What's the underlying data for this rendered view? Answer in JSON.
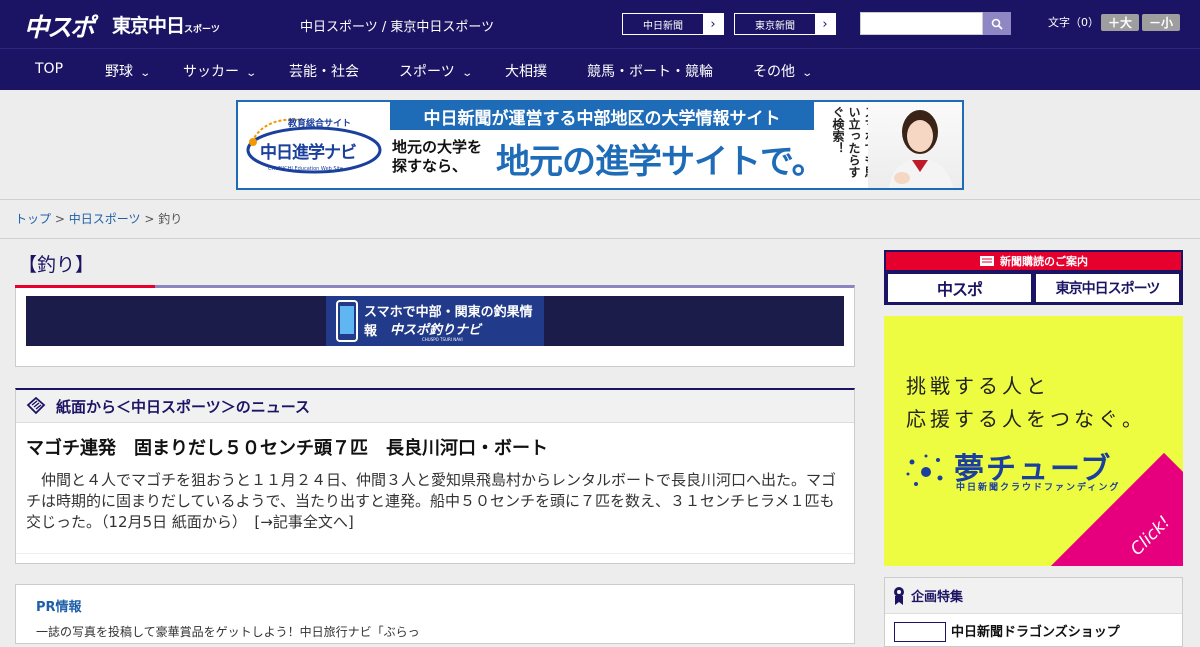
{
  "header": {
    "logo_main": "中スポ",
    "logo_tokyo": "東京中日",
    "logo_tokyo_small": "スポーツ",
    "site_title": "中日スポーツ / 東京中日スポーツ",
    "btn_chunichi": "中日新聞",
    "btn_tokyo": "東京新聞",
    "arrow": "›",
    "search_placeholder": "",
    "font_size_label": "文字（0）",
    "font_larger": "＋大",
    "font_smaller": "－小"
  },
  "nav": {
    "items": [
      "TOP",
      "野球",
      "サッカー",
      "芸能・社会",
      "スポーツ",
      "大相撲",
      "競馬・ボート・競輪",
      "その他"
    ],
    "chev": "⌄"
  },
  "banner": {
    "logo_small": "教育総合サイト",
    "logo_text": "中日進学ナビ",
    "logo_sub": "CHUNICHI Education Web Site",
    "top": "中日新聞が運営する中部地区の大学情報サイト",
    "sub1": "地元の大学を",
    "sub2": "探すなら、",
    "big": "地元の進学サイトで。",
    "vertical": "スマホでも思い立ったらすぐ検索！"
  },
  "breadcrumb": {
    "top": "トップ",
    "sep": ">",
    "chuspo": "中日スポーツ",
    "current": "釣り"
  },
  "category_title": "【釣り】",
  "fishing_banner": {
    "line1": "スマホで中部・関東の釣果情報",
    "line2": "中スポ釣りナビ",
    "line3": "CHUSPO TSURI NAVI"
  },
  "news": {
    "header": "紙面から＜中日スポーツ＞のニュース",
    "headline": "マゴチ連発　固まりだし５０センチ頭７匹　長良川河口・ボート",
    "body": "　仲間と４人でマゴチを狙おうと１１月２４日、仲間３人と愛知県飛島村からレンタルボートで長良川河口へ出た。マゴチは時期的に固まりだしているようで、当たり出すと連発。船中５０センチを頭に７匹を数え、３１センチヒラメ１匹も交じった。（12月5日 紙面から）　[→記事全文へ]"
  },
  "pr": {
    "title": "PR情報",
    "text": "一誌の写真を投稿して豪華賞品をゲットしよう！中日旅行ナビ「ぶらっ"
  },
  "subscription": {
    "title": "新聞購読のご案内",
    "chuspo": "中スポ",
    "tokyo": "東京中日スポーツ"
  },
  "yume_ad": {
    "line1": "挑戦する人と",
    "line2": "応援する人をつなぐ。",
    "title": "夢チューブ",
    "sub": "中日新聞クラウドファンディング",
    "click": "Click!"
  },
  "special": {
    "header": "企画特集",
    "item": "中日新聞ドラゴンズショップ"
  }
}
